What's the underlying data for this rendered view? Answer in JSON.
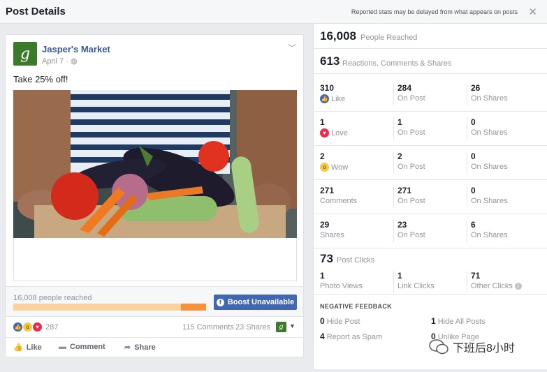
{
  "header": {
    "title": "Post Details",
    "note": "Reported stats may be delayed from what appears on posts",
    "close": "✕"
  },
  "post": {
    "avatar_letter": "g",
    "page_name": "Jasper's Market",
    "date": "April 7 · ",
    "text": "Take 25% off!",
    "reach_label": "16,008 people reached",
    "reach_progress": 0.87,
    "boost_label": "Boost Unavailable",
    "reaction_count": "287",
    "comments": "115 Comments",
    "shares": "23 Shares",
    "actions": {
      "like": "Like",
      "comment": "Comment",
      "share": "Share"
    }
  },
  "stats": {
    "reached_num": "16,008",
    "reached_label": "People Reached",
    "engage_num": "613",
    "engage_label": "Reactions, Comments & Shares",
    "rows": [
      {
        "n1": "310",
        "l1": "Like",
        "n2": "284",
        "l2": "On Post",
        "n3": "26",
        "l3": "On Shares"
      },
      {
        "n1": "1",
        "l1": "Love",
        "n2": "1",
        "l2": "On Post",
        "n3": "0",
        "l3": "On Shares"
      },
      {
        "n1": "2",
        "l1": "Wow",
        "n2": "2",
        "l2": "On Post",
        "n3": "0",
        "l3": "On Shares"
      },
      {
        "n1": "271",
        "l1": "Comments",
        "n2": "271",
        "l2": "On Post",
        "n3": "0",
        "l3": "On Shares"
      },
      {
        "n1": "29",
        "l1": "Shares",
        "n2": "23",
        "l2": "On Post",
        "n3": "6",
        "l3": "On Shares"
      }
    ],
    "clicks_num": "73",
    "clicks_label": "Post Clicks",
    "clicks": {
      "n1": "1",
      "l1": "Photo Views",
      "n2": "1",
      "l2": "Link Clicks",
      "n3": "71",
      "l3": "Other Clicks"
    },
    "negative_title": "NEGATIVE FEEDBACK",
    "negative": {
      "hide_post_n": "0",
      "hide_post": "Hide Post",
      "hide_all_n": "1",
      "hide_all": "Hide All Posts",
      "spam_n": "4",
      "spam": "Report as Spam",
      "unlike_n": "0",
      "unlike": "Unlike Page"
    }
  },
  "watermark": "下班后8小时",
  "colors": {
    "fb_blue": "#4267b2",
    "link_blue": "#365899",
    "reach_orange": "#f7923a",
    "reach_light": "#fcd19c"
  }
}
